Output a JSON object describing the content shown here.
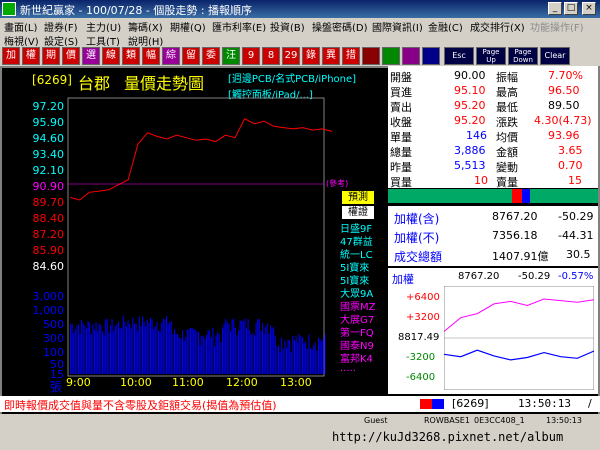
{
  "window": {
    "title": "新世紀贏家 - 100/07/28 - 個股走勢 : 播報順序"
  },
  "menu1": [
    "畫面(L)",
    "證券(F)",
    "主力(U)",
    "籌碼(X)",
    "期權(Q)",
    "匯市利率(E)",
    "投資(B)",
    "操盤密碼(D)",
    "國際資訊(I)",
    "金融(C)",
    "成交排行(X)",
    "功能操作(F)"
  ],
  "menu2": [
    "梅視(V)",
    "設定(S)",
    "工具(T)",
    "說明(H)"
  ],
  "toolbar": [
    "加",
    "權",
    "期",
    "價",
    "選",
    "線",
    "類",
    "幅",
    "綜",
    "留",
    "委",
    "汪",
    "9",
    "8",
    "29",
    "錄",
    "異",
    "措",
    "",
    "",
    "",
    "",
    "Esc",
    "Page Up",
    "Page Down",
    "Clear"
  ],
  "stock": {
    "code": "6269",
    "name": "台郡",
    "chart_title": "量價走勢圖",
    "tags_line1": "[週邊PCB/名式PCB/iPhone]",
    "tags_line2": "[觸控面板/iPad/...]"
  },
  "price_labels": [
    "97.20",
    "95.90",
    "94.60",
    "93.40",
    "92.10",
    "90.90",
    "89.70",
    "88.40",
    "87.20",
    "85.90",
    "84.60"
  ],
  "volume_labels": [
    "3,000",
    "1,000",
    "500",
    "300",
    "100",
    "50",
    "15"
  ],
  "volume_unit": "張",
  "time_labels": [
    "9:00",
    "10:00",
    "11:00",
    "12:00",
    "13:00"
  ],
  "reference_label": "(參考)",
  "side_buttons": {
    "forecast": "預測",
    "authority": "權證"
  },
  "broker_list": [
    "日盛9F",
    "47群益",
    "統一LC",
    "5I寶來",
    "5I寶來",
    "大眾9A",
    "國票MZ",
    "大展G7",
    "第一FQ",
    "國泰N9",
    "富邦K4",
    "....."
  ],
  "quote": {
    "rows": [
      {
        "l1": "開盤",
        "v1": "90.00",
        "l2": "振幅",
        "v2": "7.70%"
      },
      {
        "l1": "買進",
        "v1": "95.10",
        "l2": "最高",
        "v2": "96.50"
      },
      {
        "l1": "賣出",
        "v1": "95.20",
        "l2": "最低",
        "v2": "89.50"
      },
      {
        "l1": "收盤",
        "v1": "95.20",
        "l2": "漲跌",
        "v2": "4.30(4.73)"
      },
      {
        "l1": "單量",
        "v1": "146",
        "l2": "均價",
        "v2": "93.96"
      },
      {
        "l1": "總量",
        "v1": "3,886",
        "l2": "金額",
        "v2": "3.65"
      },
      {
        "l1": "昨量",
        "v1": "5,513",
        "l2": "變動",
        "v2": "0.70"
      },
      {
        "l1": "買量",
        "v1": "10",
        "l2": "賣量",
        "v2": "15"
      }
    ]
  },
  "index": {
    "taiex_incl_label": "加權(含)",
    "taiex_incl_value": "8767.20",
    "taiex_incl_change": "-50.29",
    "taiex_excl_label": "加權(不)",
    "taiex_excl_value": "7356.18",
    "taiex_excl_change": "-44.31",
    "turnover_label": "成交總額",
    "turnover_value": "1407.91億",
    "turnover_change": "30.5"
  },
  "mini_chart": {
    "label": "加權",
    "price": "8767.20",
    "change": "-50.29",
    "pct": "-0.57%",
    "axis": [
      "+6400",
      "+3200",
      "8817.49",
      "-3200",
      "-6400"
    ]
  },
  "status": {
    "notice": "即時報價成交值與量不含零股及鉅額交易(揭值為預估值)",
    "code": "6269",
    "time": "13:50:13",
    "page": "/"
  },
  "bottom": {
    "user": "Guest",
    "server": "ROWBASE1",
    "build": "0E3CC408_1",
    "clock": "13:50:13",
    "url": "http://kuJd3268.pixnet.net/album"
  },
  "colors": {
    "price_up": "#ff0000",
    "price_down": "#00ff00",
    "volume": "#0000ff",
    "label_cyan": "#00ffff",
    "reference": "#ff00ff"
  },
  "chart_data": [
    {
      "type": "line",
      "title": "量價走勢圖",
      "x": [
        "9:00",
        "9:10",
        "9:20",
        "9:30",
        "9:40",
        "9:50",
        "10:00",
        "10:10",
        "10:20",
        "10:30",
        "10:40",
        "10:50",
        "11:00",
        "11:10",
        "11:20",
        "11:30",
        "11:40",
        "11:50",
        "12:00",
        "12:10",
        "12:20",
        "12:30",
        "12:40",
        "12:50",
        "13:00",
        "13:10",
        "13:20",
        "13:30"
      ],
      "series": [
        {
          "values": [
            90.0,
            89.8,
            90.4,
            90.5,
            90.6,
            91.0,
            91.4,
            94.2,
            95.1,
            94.8,
            94.6,
            94.9,
            94.7,
            94.5,
            94.6,
            94.4,
            94.9,
            94.7,
            96.2,
            95.8,
            96.0,
            95.6,
            95.5,
            95.4,
            95.5,
            95.3,
            95.4,
            95.2
          ]
        }
      ],
      "ylim": [
        84.6,
        97.2
      ],
      "reference": 90.9
    },
    {
      "type": "bar",
      "unit": "張",
      "x": [
        "9:00",
        "10:00",
        "11:00",
        "12:00",
        "13:00"
      ],
      "values": [
        160,
        220,
        70,
        180,
        40
      ],
      "ylim": [
        15,
        3000
      ]
    },
    {
      "type": "line",
      "title": "加權",
      "series": [
        {
          "name": "加權",
          "values": [
            800,
            2500,
            3000,
            4200,
            4500,
            4000,
            4800,
            4600,
            4400,
            4700
          ]
        },
        {
          "values": [
            -2000,
            -2300,
            -1500,
            -2200,
            -2700,
            -2400,
            -1800,
            -2300,
            -2500,
            -1600
          ]
        }
      ],
      "ylim": [
        -6400,
        6400
      ]
    }
  ]
}
